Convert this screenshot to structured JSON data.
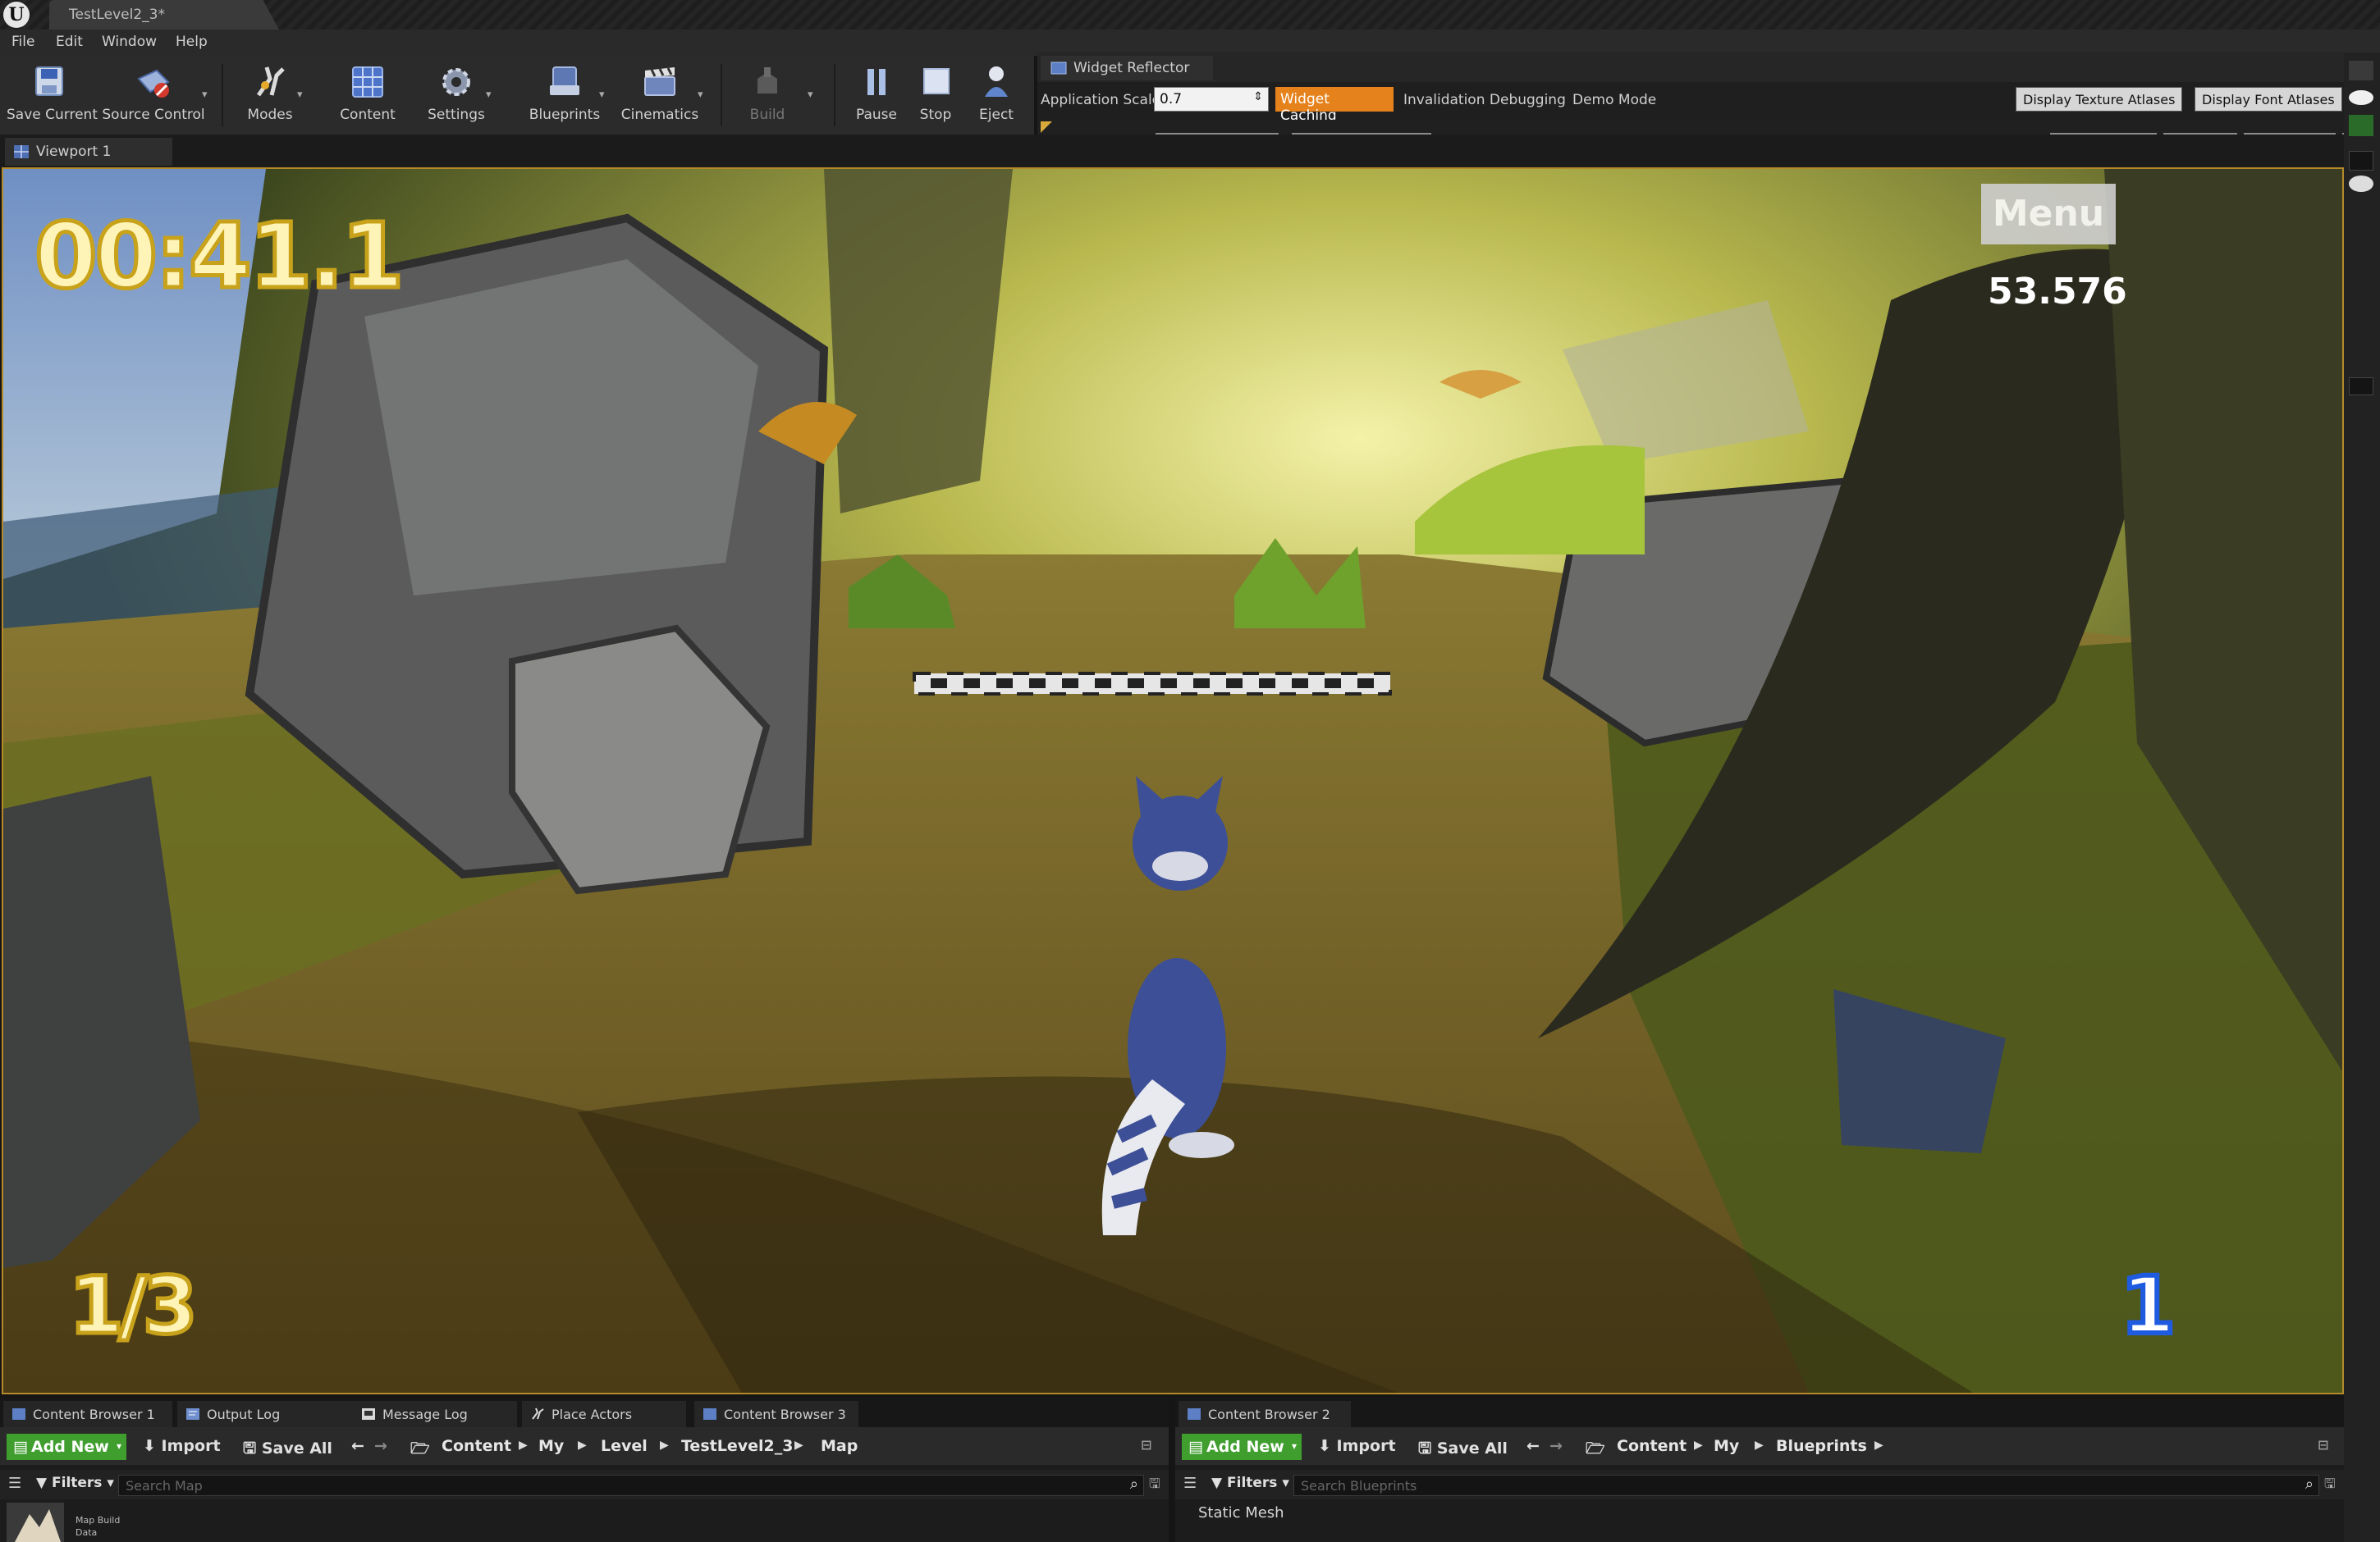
{
  "window": {
    "logo": "U",
    "doc_tab": "TestLevel2_3*"
  },
  "menu": [
    "File",
    "Edit",
    "Window",
    "Help"
  ],
  "toolbar": {
    "save_current": "Save Current",
    "source_control": "Source Control",
    "modes": "Modes",
    "content": "Content",
    "settings": "Settings",
    "blueprints": "Blueprints",
    "cinematics": "Cinematics",
    "build": "Build",
    "pause": "Pause",
    "stop": "Stop",
    "eject": "Eject"
  },
  "reflector": {
    "tab_title": "Widget Reflector",
    "app_scale_label": "Application Scale:",
    "app_scale_value": "0.7",
    "widget_caching": "Widget Caching",
    "invalidation": "Invalidation Debugging",
    "demo_mode": "Demo Mode",
    "texture_atlases": "Display Texture Atlases",
    "font_atlases": "Display Font Atlases"
  },
  "viewport": {
    "tab_title": "Viewport 1",
    "hud": {
      "timer": "00:41.1",
      "menu_button": "Menu",
      "fps": "53.576",
      "lap": "1/3",
      "position": "1"
    }
  },
  "content_browser_left": {
    "tabs": [
      "Content Browser 1",
      "Output Log",
      "Message Log",
      "Place Actors",
      "Content Browser 3"
    ],
    "add_new": "Add New",
    "import": "Import",
    "save_all": "Save All",
    "path": [
      "Content",
      "My",
      "Level",
      "TestLevel2_3",
      "Map"
    ],
    "filters": "Filters",
    "search_placeholder": "Search Map",
    "asset_label": "Map Build Data"
  },
  "content_browser_right": {
    "tabs": [
      "Content Browser 2"
    ],
    "add_new": "Add New",
    "import": "Import",
    "save_all": "Save All",
    "path": [
      "Content",
      "My",
      "Blueprints"
    ],
    "filters": "Filters",
    "search_placeholder": "Search Blueprints",
    "static_mesh": "Static Mesh"
  },
  "colors": {
    "accent_orange": "#e5821c",
    "add_new_green": "#3f9e2e",
    "viewport_border": "#b48a29",
    "hud_yellow": "#fff4b8",
    "hud_position_blue": "#1e5be0"
  }
}
